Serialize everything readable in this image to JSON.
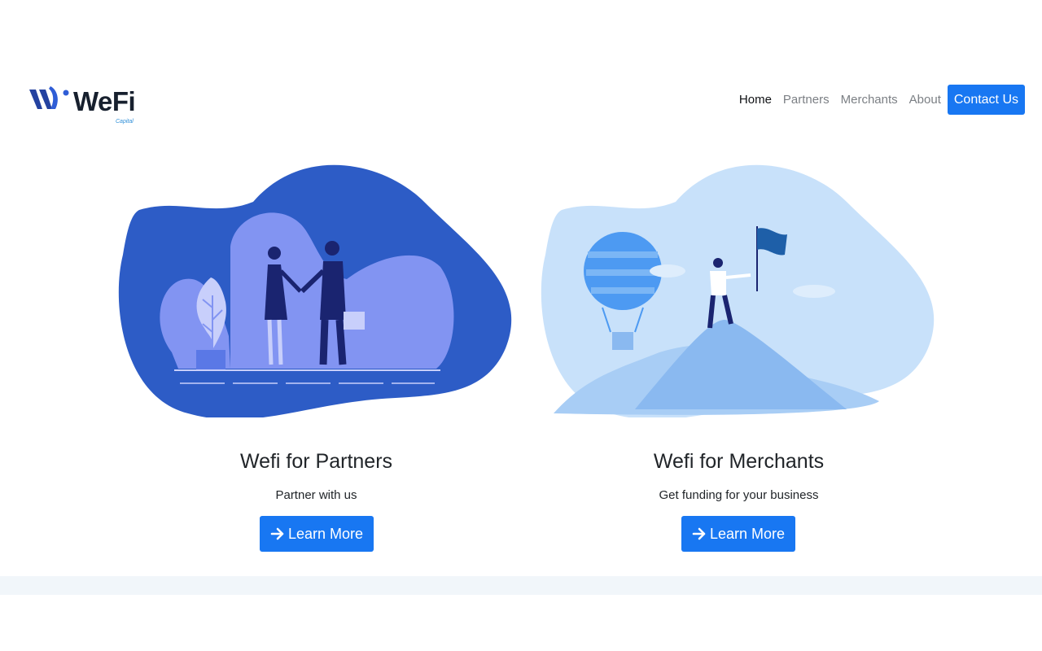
{
  "brand": {
    "name": "WeFi",
    "subtitle": "Capital"
  },
  "nav": {
    "items": [
      "Home",
      "Partners",
      "Merchants",
      "About"
    ],
    "active": "Home",
    "contact_label": "Contact Us"
  },
  "cards": [
    {
      "title": "Wefi for Partners",
      "text": "Partner with us",
      "button_label": "Learn More",
      "button_icon": "arrow-right-icon",
      "illustration": "handshake-illustration"
    },
    {
      "title": "Wefi for Merchants",
      "text": "Get funding for your business",
      "button_label": "Learn More",
      "button_icon": "arrow-right-icon",
      "illustration": "mountain-flag-illustration"
    }
  ],
  "colors": {
    "primary": "#1877f2",
    "brand_dark": "#17202e",
    "blob_dark": "#2d5cc6",
    "blob_light": "#c8e1fa",
    "footer_band": "#f1f6fa"
  }
}
